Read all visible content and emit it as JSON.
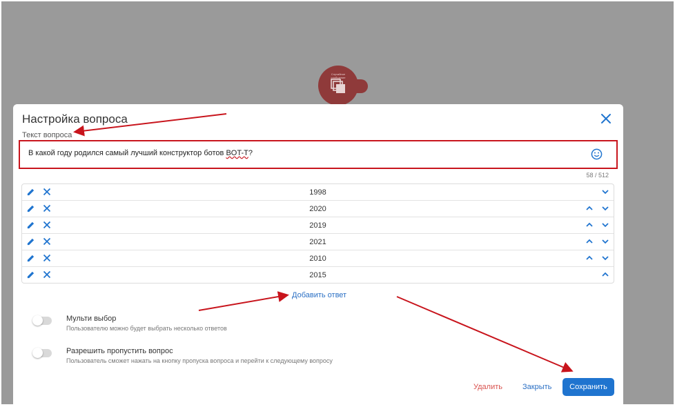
{
  "bot_node": {
    "caption": "Случайное сообщение"
  },
  "dialog": {
    "title": "Настройка вопроса",
    "question_label": "Текст вопроса",
    "question_text_prefix": "В какой году родился самый лучший конструктор ботов ",
    "question_text_highlight": "BOT-T",
    "question_text_suffix": "?",
    "char_counter": "58 / 512",
    "answers": [
      {
        "value": "1998"
      },
      {
        "value": "2020"
      },
      {
        "value": "2019"
      },
      {
        "value": "2021"
      },
      {
        "value": "2010"
      },
      {
        "value": "2015"
      }
    ],
    "add_answer_label": "Добавить ответ",
    "options": [
      {
        "title": "Мульти выбор",
        "description": "Пользователю можно будет выбрать несколько ответов",
        "enabled": false
      },
      {
        "title": "Разрешить пропустить вопрос",
        "description": "Пользователь сможет нажать на кнопку пропуска вопроса и перейти к следующему вопросу",
        "enabled": false
      }
    ],
    "buttons": {
      "delete": "Удалить",
      "close": "Закрыть",
      "save": "Сохранить"
    }
  },
  "colors": {
    "accent": "#1f74cf",
    "danger": "#d9534f",
    "annotation": "#c8141c",
    "backdrop": "#9a9a9a",
    "bot_node": "#8f3a3a"
  },
  "icons": {
    "edit": "pencil-icon",
    "delete": "close-icon",
    "up": "chevron-up-icon",
    "down": "chevron-down-icon",
    "emoji": "smiley-icon"
  }
}
